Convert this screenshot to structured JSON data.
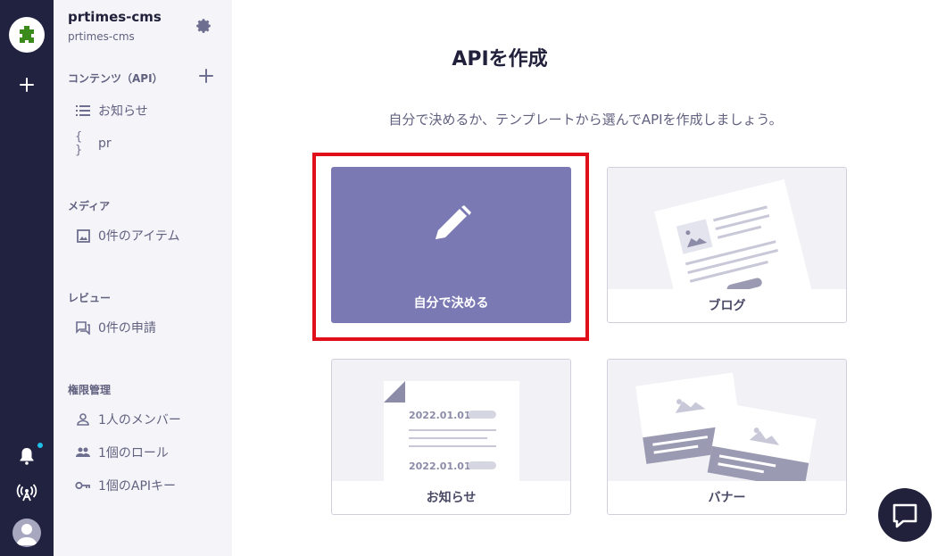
{
  "sidebar": {
    "service_name": "prtimes-cms",
    "service_id": "prtimes-cms",
    "content_section": "コンテンツ（API）",
    "content_items": [
      {
        "label": "お知らせ",
        "icon": "list-icon"
      },
      {
        "label": "pr",
        "icon": "braces-icon"
      }
    ],
    "media_section": "メディア",
    "media_items": [
      {
        "label": "0件のアイテム",
        "icon": "image-icon"
      }
    ],
    "review_section": "レビュー",
    "review_items": [
      {
        "label": "0件の申請",
        "icon": "review-icon"
      }
    ],
    "permission_section": "権限管理",
    "permission_items": [
      {
        "label": "1人のメンバー",
        "icon": "person-icon"
      },
      {
        "label": "1個のロール",
        "icon": "people-icon"
      },
      {
        "label": "1個のAPIキー",
        "icon": "key-icon"
      }
    ]
  },
  "main": {
    "title": "APIを作成",
    "description": "自分で決めるか、テンプレートから選んでAPIを作成しましょう。",
    "cards": [
      {
        "label": "自分で決める",
        "icon": "pencil-icon",
        "highlighted": true
      },
      {
        "label": "ブログ",
        "icon": "blog-template-illustration"
      },
      {
        "label": "お知らせ",
        "icon": "news-template-illustration",
        "dates": [
          "2022.01.01",
          "2022.01.01"
        ]
      },
      {
        "label": "バナー",
        "icon": "banner-template-illustration"
      }
    ]
  },
  "colors": {
    "rail": "#212140",
    "sidebar": "#f5f5f9",
    "primary_card": "#7a79b4",
    "highlight": "#e0101a",
    "notification_dot": "#20c0e8"
  }
}
